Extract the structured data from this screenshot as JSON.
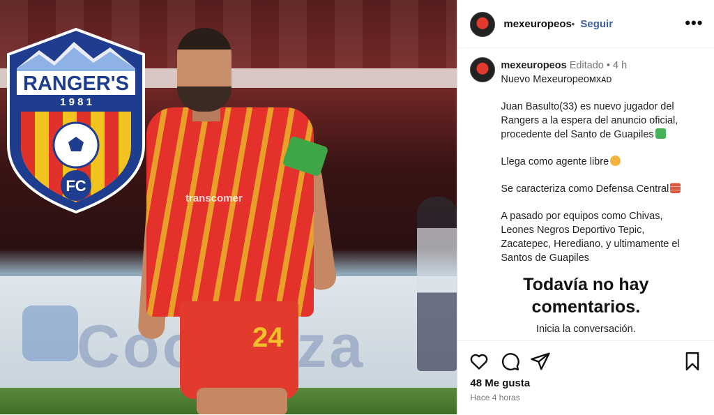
{
  "post": {
    "image_alt": "Juan Basulto Rangers FC",
    "crest": {
      "name": "RANGER'S",
      "year": "1 9 8 1",
      "letters": "FC"
    },
    "jersey_number": "24",
    "jersey_sponsor": "transcomer"
  },
  "header": {
    "username": "mexeuropeos",
    "separator": "•",
    "follow_label": "Seguir",
    "more_label": "•••"
  },
  "caption": {
    "username": "mexeuropeos",
    "edited_label": "Editado",
    "separator": "•",
    "time": "4 h",
    "lines": [
      "Nuevo Mexeuropeoᴍxᴀᴅ",
      "",
      "Juan Basulto(33) es nuevo jugador del",
      "Rangers a la espera del anuncio oficial,",
      "procedente del Santo de Guapiles",
      "",
      "Llega como agente libre",
      "",
      "Se caracteriza como Defensa Central",
      "",
      "A pasado por equipos como Chivas,",
      "Leones Negros Deportivo Tepic,",
      "Zacatepec, Herediano, y ultimamente el",
      "Santos de Guapiles"
    ]
  },
  "comments": {
    "empty_title_1": "Todavía no hay",
    "empty_title_2": "comentarios.",
    "empty_subtitle": "Inicia la conversación."
  },
  "footer": {
    "likes": "48 Me gusta",
    "timestamp": "Hace 4 horas"
  },
  "icons": {
    "like": "heart-icon",
    "comment": "comment-icon",
    "share": "send-icon",
    "save": "bookmark-icon"
  },
  "colors": {
    "follow": "#3b5fa0",
    "crest_blue": "#1f3d8f",
    "crest_red": "#e0322b",
    "crest_yellow": "#f2c21f"
  }
}
